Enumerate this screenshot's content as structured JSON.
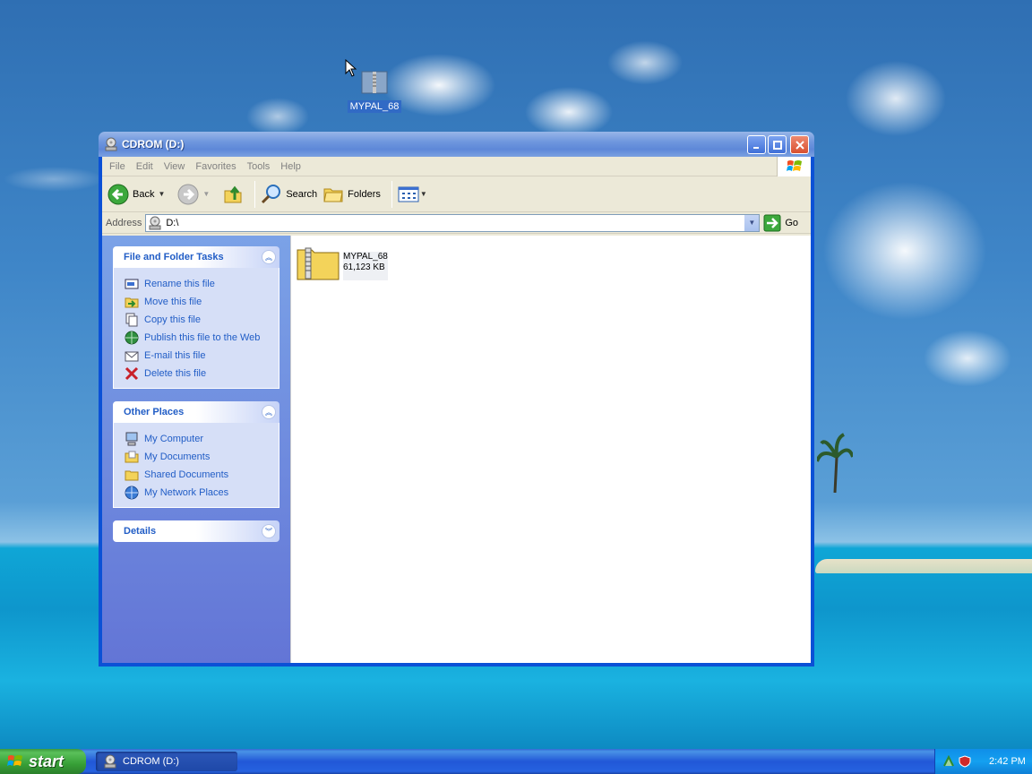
{
  "desktop": {
    "icon_label": "MYPAL_68"
  },
  "window": {
    "title": "CDROM (D:)",
    "menu": [
      "File",
      "Edit",
      "View",
      "Favorites",
      "Tools",
      "Help"
    ],
    "toolbar": {
      "back_label": "Back",
      "search_label": "Search",
      "folders_label": "Folders"
    },
    "address": {
      "label": "Address",
      "value": "D:\\",
      "go_label": "Go"
    },
    "tasks_panel": {
      "title": "File and Folder Tasks",
      "items": [
        {
          "label": "Rename this file",
          "icon": "rename-icon"
        },
        {
          "label": "Move this file",
          "icon": "move-icon"
        },
        {
          "label": "Copy this file",
          "icon": "copy-icon"
        },
        {
          "label": "Publish this file to the Web",
          "icon": "globe-icon"
        },
        {
          "label": "E-mail this file",
          "icon": "email-icon"
        },
        {
          "label": "Delete this file",
          "icon": "delete-icon"
        }
      ]
    },
    "places_panel": {
      "title": "Other Places",
      "items": [
        {
          "label": "My Computer",
          "icon": "computer-icon"
        },
        {
          "label": "My Documents",
          "icon": "documents-folder-icon"
        },
        {
          "label": "Shared Documents",
          "icon": "shared-folder-icon"
        },
        {
          "label": "My Network Places",
          "icon": "network-icon"
        }
      ]
    },
    "details_panel": {
      "title": "Details"
    },
    "file": {
      "name": "MYPAL_68",
      "size": "61,123 KB"
    }
  },
  "taskbar": {
    "start_label": "start",
    "task_button_label": "CDROM (D:)",
    "clock": "2:42 PM"
  }
}
